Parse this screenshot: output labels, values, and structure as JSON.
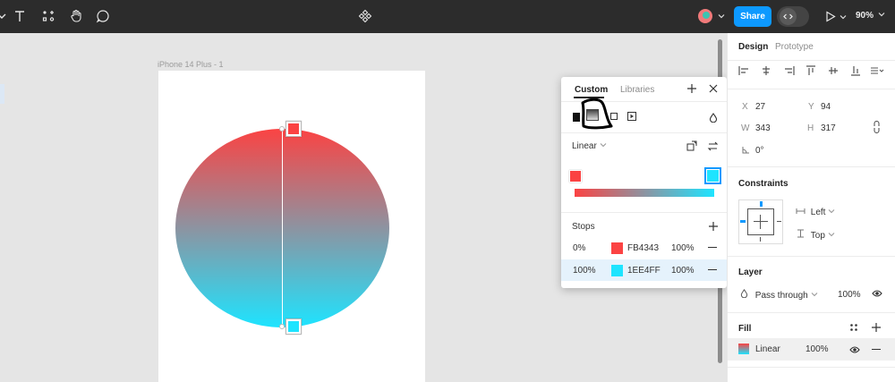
{
  "toolbar": {
    "share_label": "Share",
    "zoom_label": "90%",
    "icons": [
      "chevron-down-icon",
      "text-tool-icon",
      "resources-icon",
      "hand-tool-icon",
      "comment-tool-icon",
      "figma-components-icon",
      "avatar",
      "dev-mode-icon",
      "play-icon"
    ]
  },
  "canvas": {
    "frame_label": "iPhone 14 Plus - 1"
  },
  "fill": {
    "stop_colors": [
      "#FB4343",
      "#1EE4FF"
    ]
  },
  "picker": {
    "tab_custom": "Custom",
    "tab_libraries": "Libraries",
    "type_label": "Linear",
    "stops_label": "Stops",
    "stops": [
      {
        "position": "0%",
        "hex": "FB4343",
        "opacity": "100%",
        "color": "#FB4343"
      },
      {
        "position": "100%",
        "hex": "1EE4FF",
        "opacity": "100%",
        "color": "#1EE4FF"
      }
    ]
  },
  "design_panel": {
    "tab_design": "Design",
    "tab_prototype": "Prototype",
    "x_label": "X",
    "x_value": "27",
    "y_label": "Y",
    "y_value": "94",
    "w_label": "W",
    "w_value": "343",
    "h_label": "H",
    "h_value": "317",
    "rotation_label": "0°",
    "constraints_title": "Constraints",
    "constraint_h": "Left",
    "constraint_v": "Top",
    "layer_title": "Layer",
    "blend_mode": "Pass through",
    "layer_opacity": "100%",
    "fill_title": "Fill",
    "fill_type": "Linear",
    "fill_opacity": "100%"
  }
}
